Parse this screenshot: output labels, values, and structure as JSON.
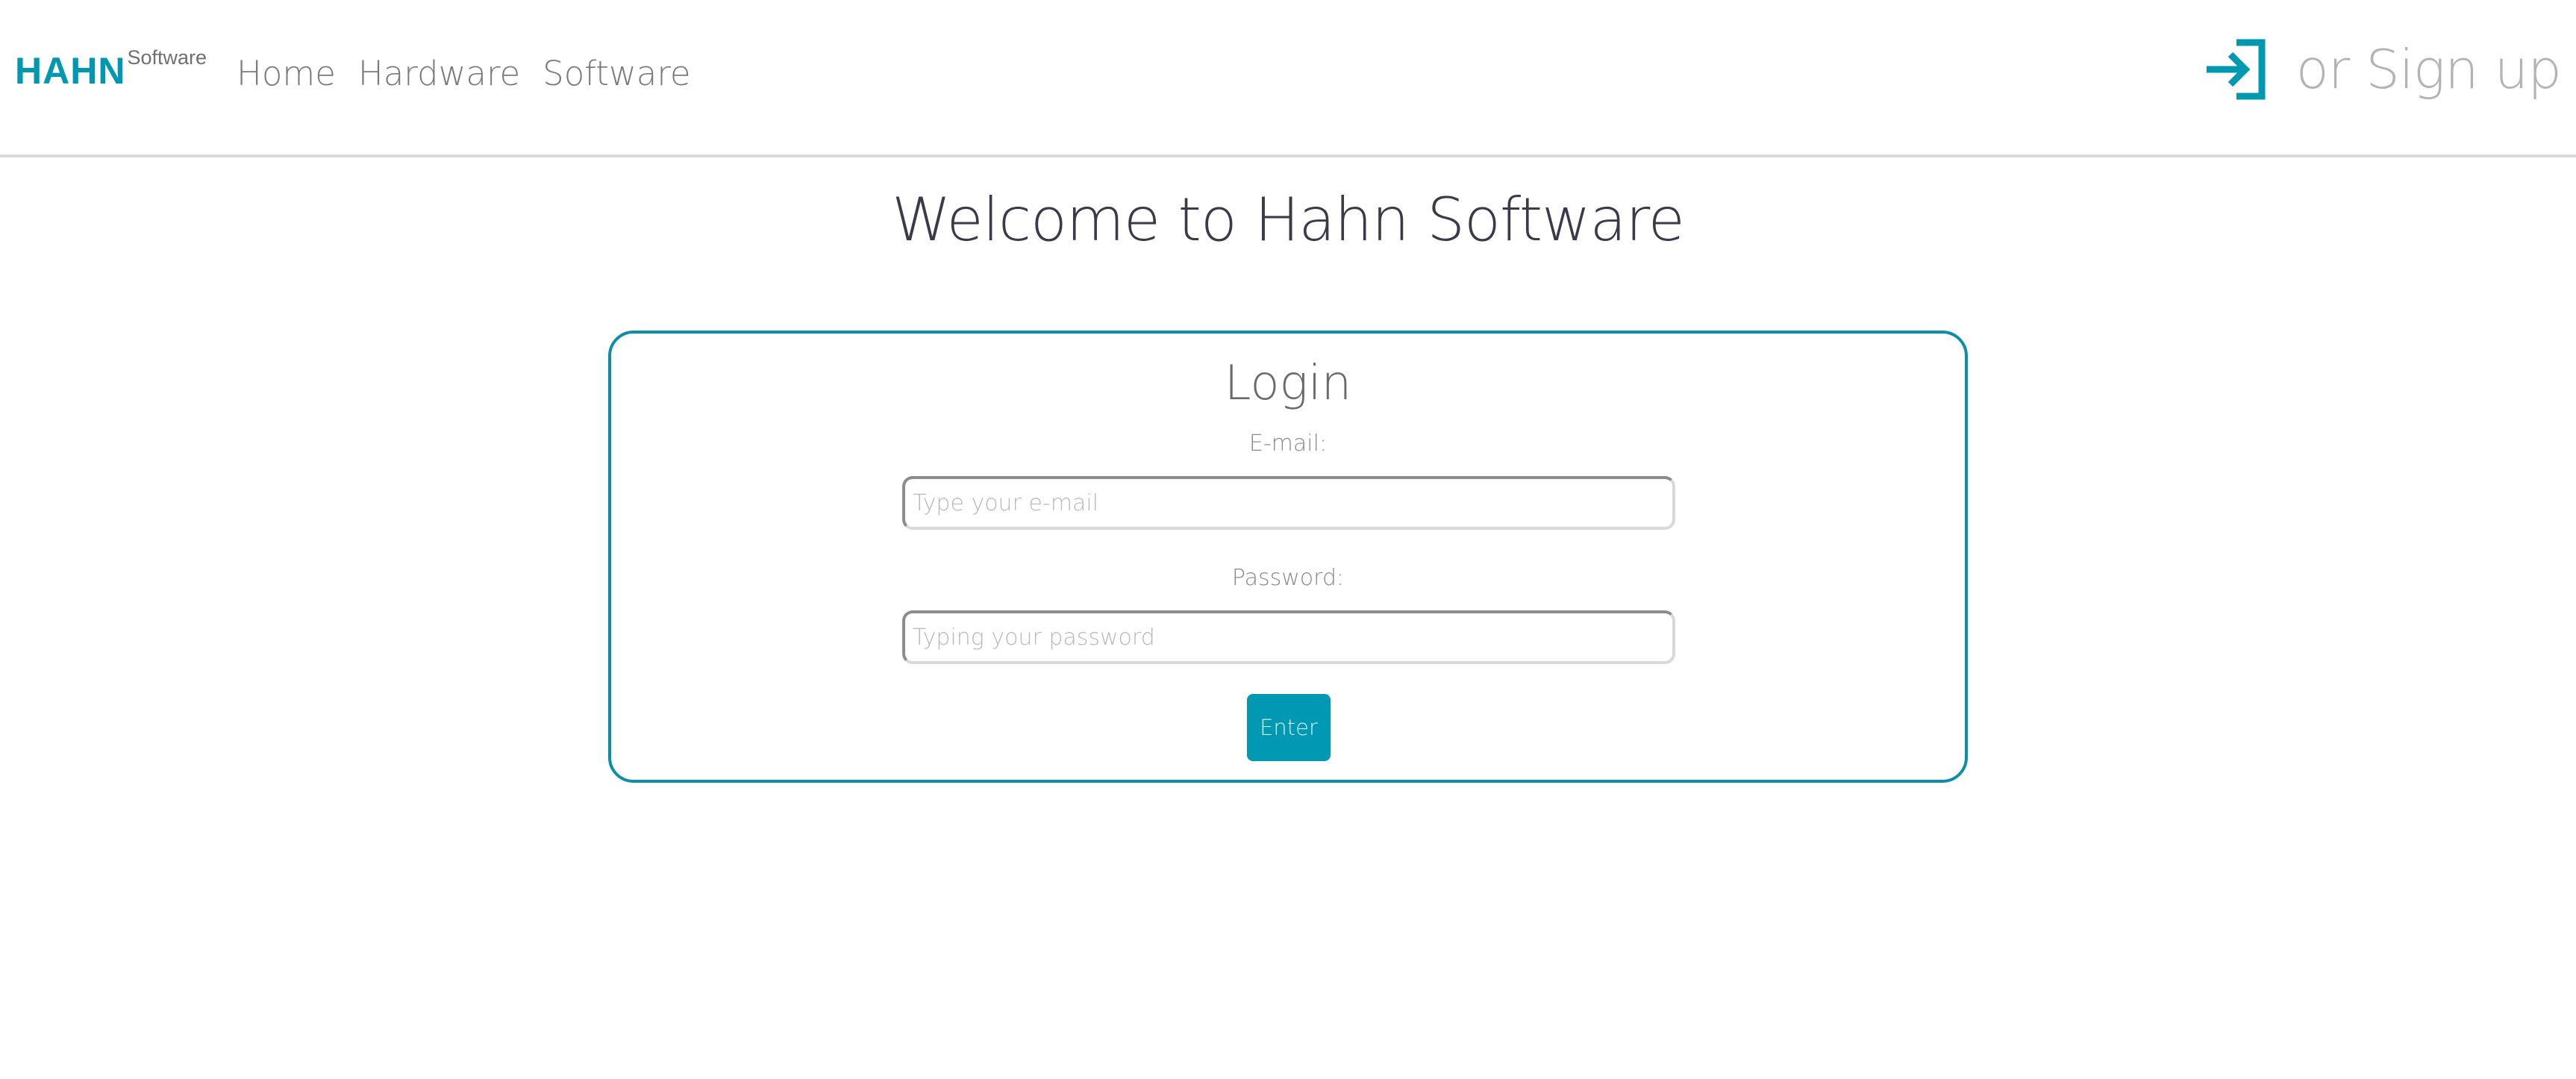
{
  "colors": {
    "brand": "#0098b0",
    "card_border": "#0b8fa8",
    "button": "#0098b3"
  },
  "nav": {
    "logo": {
      "main": "HAHN",
      "sub": "Software"
    },
    "links": [
      {
        "label": "Home"
      },
      {
        "label": "Hardware"
      },
      {
        "label": "Software"
      }
    ],
    "signin_icon": "sign-in-arrow-icon",
    "signup_label": "or Sign up"
  },
  "main": {
    "title": "Welcome to Hahn Software"
  },
  "login": {
    "title": "Login",
    "email_label": "E-mail:",
    "email_placeholder": "Type your e-mail",
    "email_value": "",
    "password_label": "Password:",
    "password_placeholder": "Typing your password",
    "password_value": "",
    "submit_label": "Enter"
  }
}
